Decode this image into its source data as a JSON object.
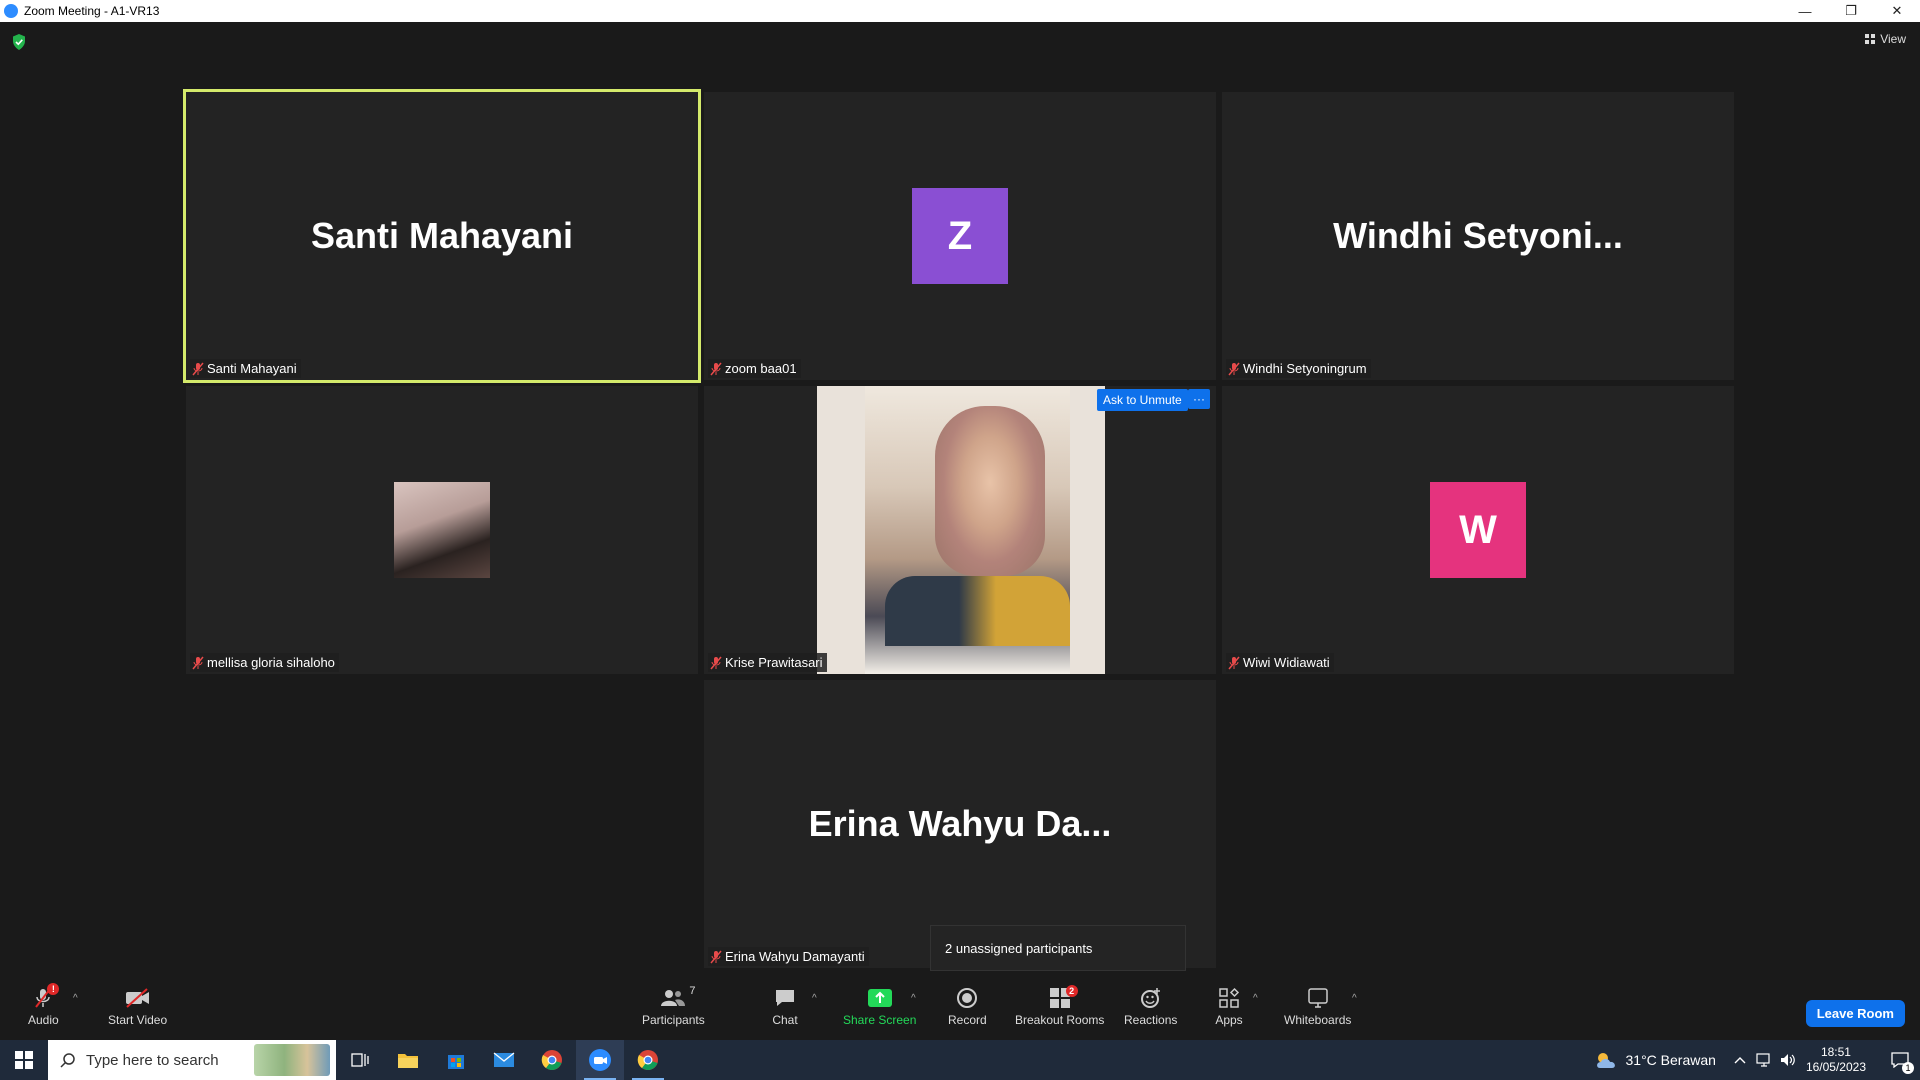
{
  "window": {
    "title": "Zoom Meeting - A1-VR13",
    "minimize": "—",
    "restore": "❐",
    "close": "✕"
  },
  "meeting": {
    "view_label": "View",
    "tiles": [
      {
        "display": "Santi Mahayani",
        "name": "Santi Mahayani",
        "type": "name",
        "active": true
      },
      {
        "display": "Z",
        "name": "zoom baa01",
        "type": "letter",
        "color": "#8a4fd3"
      },
      {
        "display": "Windhi  Setyoni...",
        "name": "Windhi Setyoningrum",
        "type": "name"
      },
      {
        "display": "",
        "name": "mellisa gloria sihaloho",
        "type": "photo"
      },
      {
        "display": "",
        "name": "Krise Prawitasari",
        "type": "video"
      },
      {
        "display": "W",
        "name": "Wiwi Widiawati",
        "type": "letter",
        "color": "#e5337e"
      },
      {
        "display": "Erina  Wahyu  Da...",
        "name": "Erina Wahyu Damayanti",
        "type": "name"
      }
    ],
    "ask_to_unmute": "Ask to Unmute",
    "more": "···",
    "tooltip": "2 unassigned participants"
  },
  "toolbar": {
    "audio": {
      "label": "Audio",
      "badge": "!"
    },
    "video": {
      "label": "Start Video"
    },
    "participants": {
      "label": "Participants",
      "count": "7"
    },
    "chat": {
      "label": "Chat"
    },
    "share": {
      "label": "Share Screen"
    },
    "record": {
      "label": "Record"
    },
    "breakout": {
      "label": "Breakout Rooms",
      "badge": "2"
    },
    "reactions": {
      "label": "Reactions"
    },
    "apps": {
      "label": "Apps"
    },
    "whiteboards": {
      "label": "Whiteboards"
    },
    "leave": "Leave Room",
    "caret": "^"
  },
  "taskbar": {
    "search_placeholder": "Type here to search",
    "weather": "31°C  Berawan",
    "time": "18:51",
    "date": "16/05/2023",
    "notif_count": "1"
  },
  "colors": {
    "accent": "#0e71eb",
    "active_border": "#d4ea6b",
    "share_green": "#23d959",
    "badge_red": "#e02828"
  }
}
